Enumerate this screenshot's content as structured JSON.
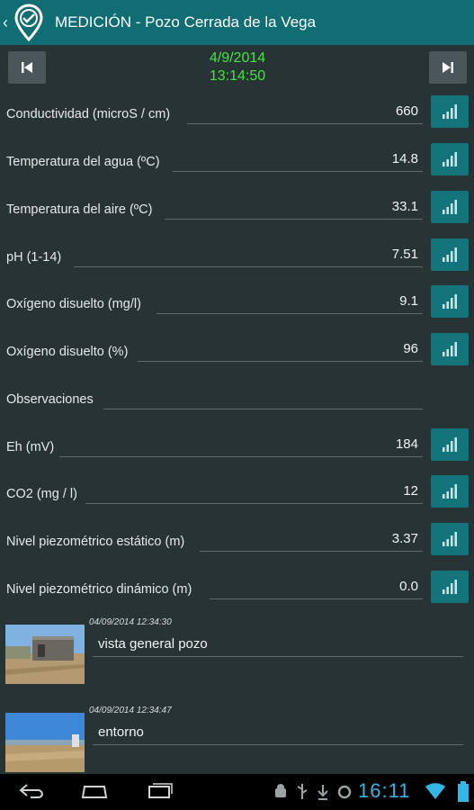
{
  "actionbar": {
    "title": "MEDICIÓN - Pozo Cerrada de la Vega",
    "icons": {
      "back": "chevron-left-icon",
      "logo": "location-pin-check-icon"
    }
  },
  "navigation": {
    "date": "4/9/2014",
    "time": "13:14:50",
    "prev_icon": "skip-previous-icon",
    "next_icon": "skip-next-icon"
  },
  "measurements": [
    {
      "label": "Conductividad (microS / cm)",
      "value": "660",
      "chart": true
    },
    {
      "label": "Temperatura del agua (ºC)",
      "value": "14.8",
      "chart": true
    },
    {
      "label": "Temperatura del aire (ºC)",
      "value": "33.1",
      "chart": true
    },
    {
      "label": "pH (1-14)",
      "value": "7.51",
      "chart": true
    },
    {
      "label": "Oxígeno disuelto (mg/l)",
      "value": "9.1",
      "chart": true
    },
    {
      "label": "Oxígeno disuelto (%)",
      "value": "96",
      "chart": true
    },
    {
      "label": "Observaciones",
      "value": "",
      "chart": false
    },
    {
      "label": "Eh (mV)",
      "value": "184",
      "chart": true
    },
    {
      "label": "CO2 (mg / l)",
      "value": "12",
      "chart": true
    },
    {
      "label": "Nivel piezométrico estático (m)",
      "value": "3.37",
      "chart": true
    },
    {
      "label": "Nivel piezométrico dinámico (m)",
      "value": "0.0",
      "chart": true
    }
  ],
  "photos": [
    {
      "timestamp": "04/09/2014 12:34:30",
      "caption": "vista general pozo"
    },
    {
      "timestamp": "04/09/2014 12:34:47",
      "caption": "entorno"
    }
  ],
  "system": {
    "clock": "16:11",
    "icons": [
      "back-icon",
      "home-icon",
      "recent-apps-icon",
      "android-debug-icon",
      "usb-icon",
      "download-icon",
      "sync-icon",
      "wifi-icon",
      "battery-icon"
    ],
    "accent": "#33b5e5"
  },
  "colors": {
    "actionbar": "#0f6d73",
    "background": "#283336",
    "chart_button": "#13757b",
    "datetime": "#3ee83b"
  }
}
